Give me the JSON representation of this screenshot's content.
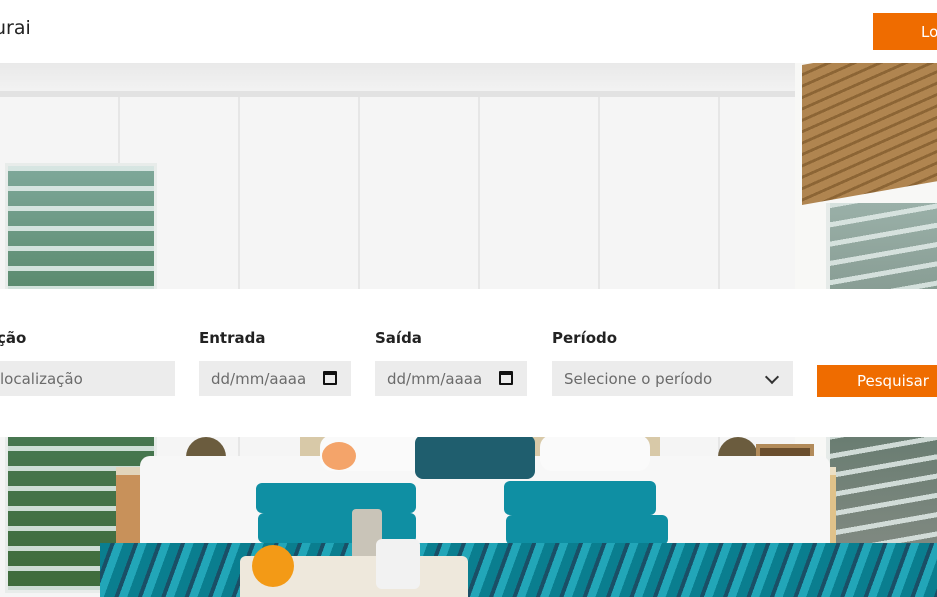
{
  "header": {
    "brand_visible": "urai",
    "login_label": "Lo"
  },
  "search": {
    "location": {
      "label": "ção",
      "placeholder": " localização"
    },
    "checkin": {
      "label": "Entrada",
      "placeholder": "dd/mm/aaaa"
    },
    "checkout": {
      "label": "Saída",
      "placeholder": "dd/mm/aaaa"
    },
    "period": {
      "label": "Período",
      "selected": "Selecione o período"
    },
    "submit_label": "Pesquisar"
  },
  "icons": {
    "checkin": "calendar-icon",
    "checkout": "calendar-icon",
    "period": "chevron-down-icon"
  },
  "colors": {
    "accent": "#ef6c00",
    "field_bg": "#ececec",
    "text": "#222222"
  }
}
